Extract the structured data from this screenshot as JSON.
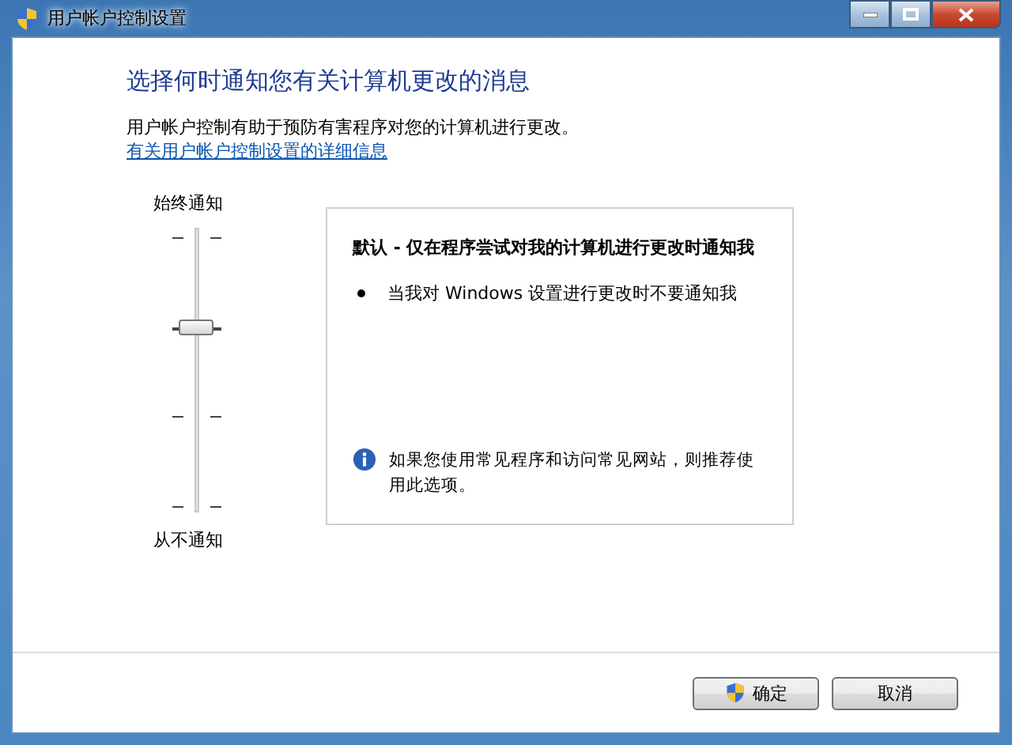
{
  "window": {
    "title": "用户帐户控制设置"
  },
  "heading": "选择何时通知您有关计算机更改的消息",
  "description": "用户帐户控制有助于预防有害程序对您的计算机进行更改。",
  "link": "有关用户帐户控制设置的详细信息",
  "slider": {
    "top_label": "始终通知",
    "bottom_label": "从不通知",
    "level": 0.667
  },
  "info_panel": {
    "title": "默认 - 仅在程序尝试对我的计算机进行更改时通知我",
    "bullets": [
      "当我对 Windows 设置进行更改时不要通知我"
    ],
    "note": "如果您使用常见程序和访问常见网站，则推荐使用此选项。"
  },
  "buttons": [
    {
      "label": "确定",
      "shield": true
    },
    {
      "label": "取消",
      "shield": false
    }
  ]
}
